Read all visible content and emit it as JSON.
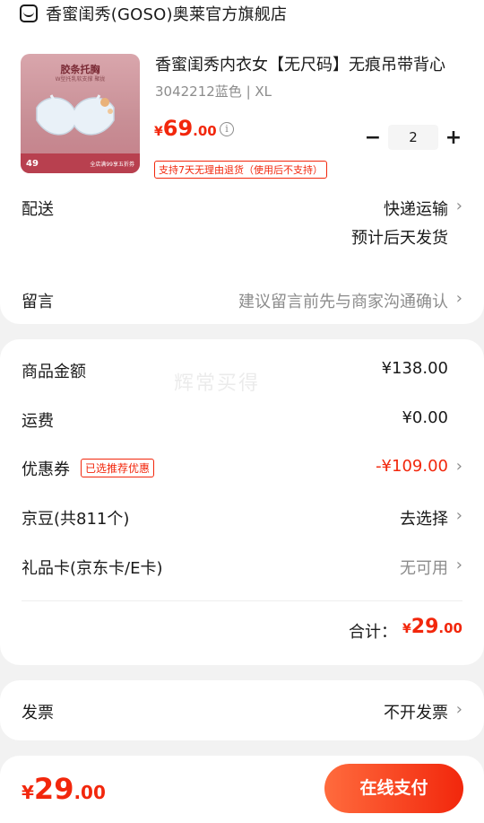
{
  "shop": {
    "name": "香蜜闺秀(GOSO)奥莱官方旗舰店",
    "icon": "shop-icon"
  },
  "product": {
    "title": "香蜜闺秀内衣女【无尺码】无痕吊带背心",
    "spec": "3042212蓝色 | XL",
    "price_currency": "¥",
    "price_int": "69",
    "price_dec": ".00",
    "quantity": "2",
    "minus": "−",
    "plus": "+",
    "return_badge": "支持7天无理由退货（使用后不支持）",
    "image": {
      "tag": "胶条托胸",
      "sub": "W型托乳软支撑 聚拢",
      "strip_left": "49",
      "strip_right": "全店满99享五折券"
    }
  },
  "delivery": {
    "label": "配送",
    "method": "快递运输",
    "eta": "预计后天发货"
  },
  "message": {
    "label": "留言",
    "placeholder": "建议留言前先与商家沟通确认"
  },
  "summary": {
    "goods_label": "商品金额",
    "goods_value": "¥138.00",
    "freight_label": "运费",
    "freight_value": "¥0.00",
    "coupon_label": "优惠券",
    "coupon_badge": "已选推荐优惠",
    "coupon_value": "-¥109.00",
    "beans_label": "京豆(共811个)",
    "beans_value": "去选择",
    "giftcard_label": "礼品卡(京东卡/E卡)",
    "giftcard_value": "无可用",
    "total_label": "合计：",
    "total_currency": "¥",
    "total_int": "29",
    "total_dec": ".00"
  },
  "watermark": "辉常买得",
  "invoice": {
    "label": "发票",
    "value": "不开发票"
  },
  "footer": {
    "currency": "¥",
    "amount_int": "29",
    "amount_dec": ".00",
    "pay_label": "在线支付"
  },
  "colors": {
    "accent": "#f2270c",
    "muted": "#8c8c8c"
  }
}
